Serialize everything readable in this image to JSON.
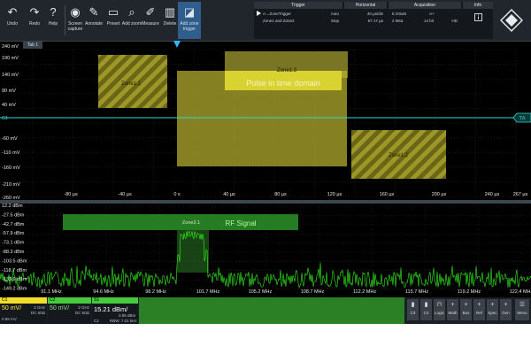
{
  "toolbar": {
    "buttons": [
      {
        "label": "Undo",
        "icon": "↶"
      },
      {
        "label": "Redo",
        "icon": "↷"
      },
      {
        "label": "Help",
        "icon": "?"
      },
      {
        "label": "Screen capture",
        "icon": "◉"
      },
      {
        "label": "Annotate",
        "icon": "✎"
      },
      {
        "label": "Preset",
        "icon": "▭"
      },
      {
        "label": "Add zoom",
        "icon": "⌕"
      },
      {
        "label": "Measure",
        "icon": "✐"
      },
      {
        "label": "Delete",
        "icon": "▥"
      },
      {
        "label": "Add zone trigger",
        "icon": "◪"
      }
    ]
  },
  "info_panel": {
    "trigger": {
      "title": "Trigger",
      "line1": "A→ZoneTrigger",
      "line2": "Zone1 and Zone2",
      "mode": "Auto",
      "state": "Stop"
    },
    "horizontal": {
      "title": "Horizontal",
      "scale": "40 µs/div",
      "offset": "67.17 µs"
    },
    "acquisition": {
      "title": "Acquisition",
      "rate": "5 GSa/s",
      "points": "2 Msa",
      "mode": "A+",
      "bits": "14 bit",
      "hd": "HD"
    },
    "info": {
      "title": "Info"
    }
  },
  "tab_label": "Tab 1",
  "time_domain": {
    "y_labels": [
      "240 mV",
      "190 mV",
      "140 mV",
      "90 mV",
      "40 mV",
      "C1",
      "-60 mV",
      "-110 mV",
      "-160 mV",
      "-210 mV",
      "-260 mV"
    ],
    "x_labels": [
      "-80 µs",
      "-40 µs",
      "0 s",
      "40 µs",
      "80 µs",
      "120 µs",
      "160 µs",
      "200 µs",
      "240 µs",
      "267 µs"
    ],
    "trace_tag": "TA",
    "zones": [
      "Zone1.1",
      "Zone1.3",
      "Zone1.2"
    ],
    "pulse_label": "Pulse in time domain"
  },
  "spectrum": {
    "y_labels": [
      "12.2 dBm",
      "-27.5 dBm",
      "-42.7 dBm",
      "-57.9 dBm",
      "-73.1 dBm",
      "-88.3 dBm",
      "-103.5 dBm",
      "-118.7 dBm",
      "-133.9 dBm",
      "-149.2 dBm"
    ],
    "x_labels": [
      "91.1 MHz",
      "94.6 MHz",
      "98.2 MHz",
      "101.7 MHz",
      "105.2 MHz",
      "108.7 MHz",
      "112.2 MHz",
      "115.7 MHz",
      "119.2 MHz",
      "122.4 MHz"
    ],
    "zone": "Zone2.1",
    "rf_label": "RF Signal"
  },
  "status_bar": {
    "c1": {
      "name": "C1",
      "scale": "50 mV/",
      "coupling": "DC 50Ω",
      "offset": "0.88 mV",
      "sub": "2 GHz"
    },
    "c2": {
      "name": "C2",
      "scale": "50 mV/",
      "coupling": "DC 50Ω",
      "sub": "2 GHz"
    },
    "s1": {
      "name": "S1",
      "ref": "15.21 dBm/",
      "span": "3.95 dBm",
      "rbw": "RBW: 7.01 kHz",
      "c_label": "C2"
    },
    "right_buttons": [
      "C3",
      "C4",
      "Logic",
      "Math",
      "Bus",
      "Ref",
      "Spec",
      "Gen",
      "Menu"
    ]
  },
  "colors": {
    "trace_c1": "#34d8cc",
    "spectrum": "#33f21c",
    "zone_fill": "#d8d330",
    "rf_zone": "#2f9b2a",
    "c1_header": "#f2dd2a",
    "c2_header": "#46c93c"
  }
}
